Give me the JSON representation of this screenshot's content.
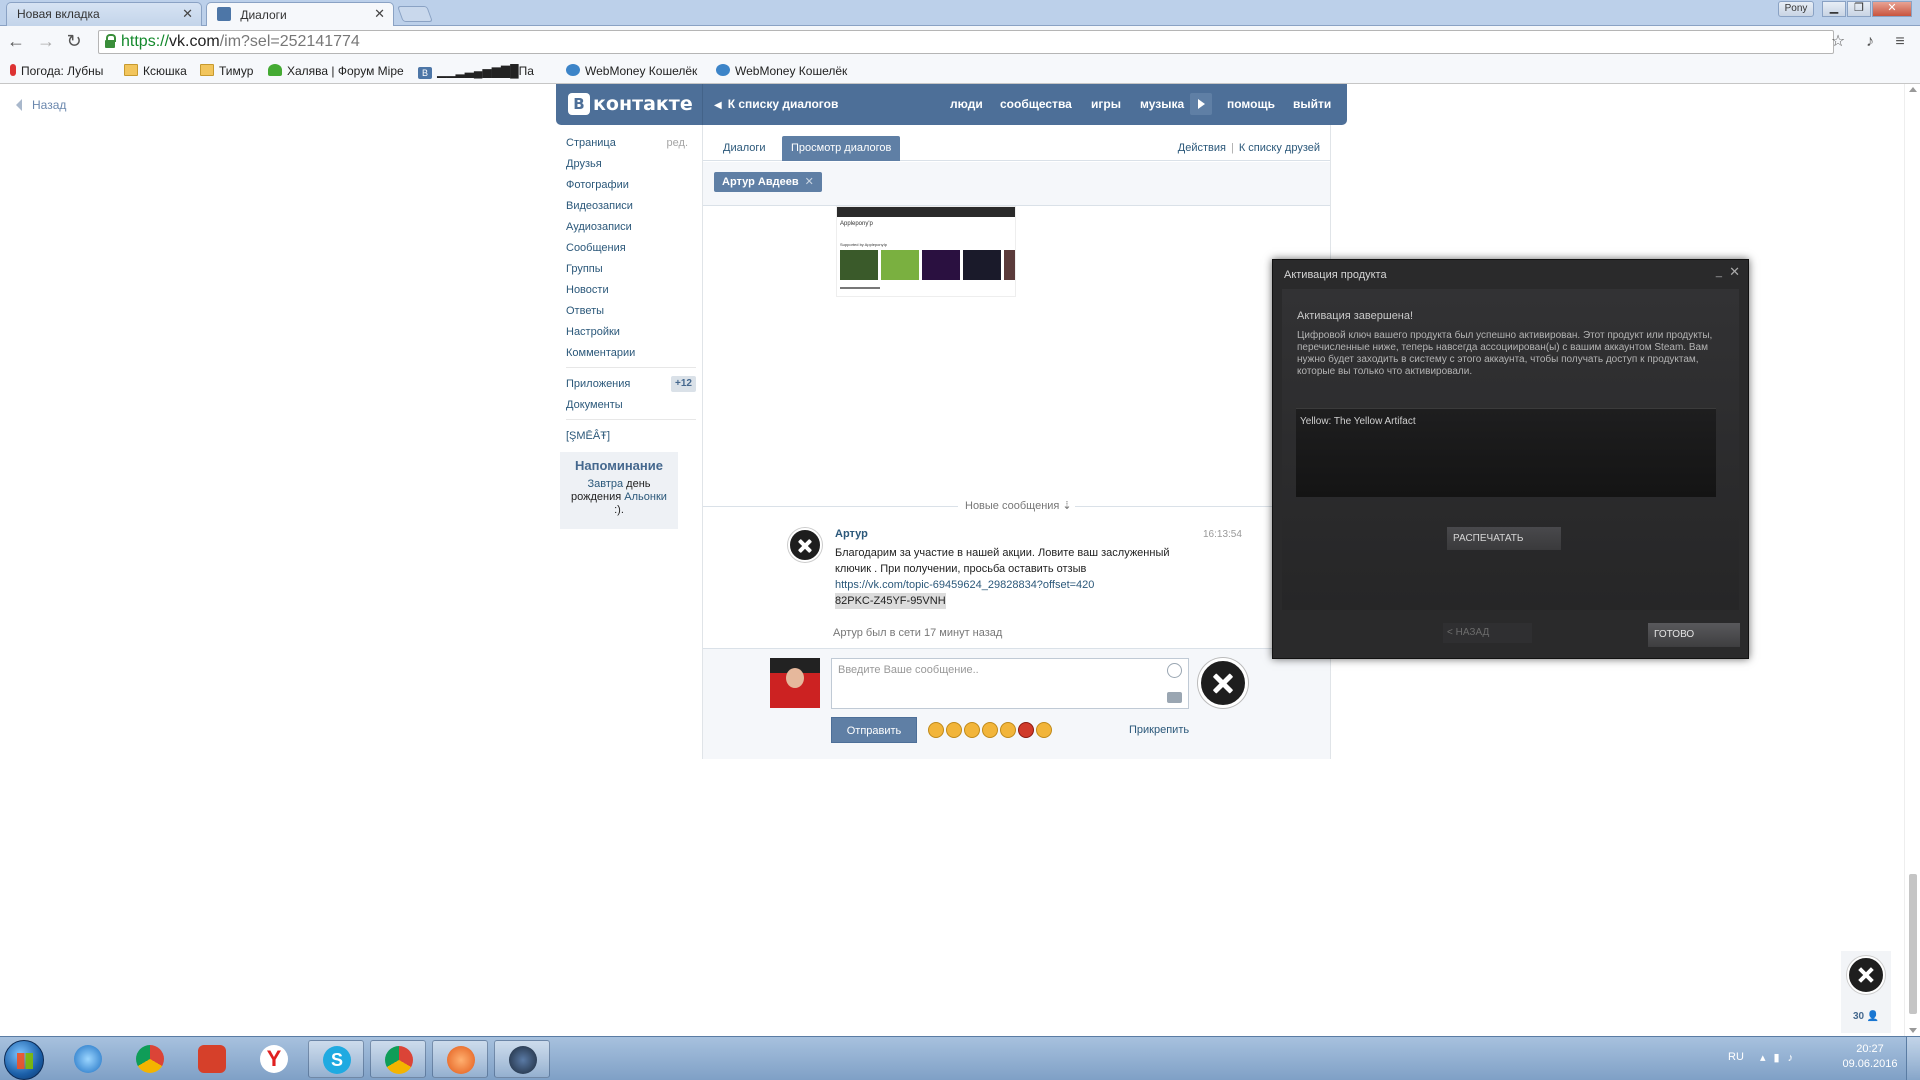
{
  "browser": {
    "tabs": [
      {
        "title": "Новая вкладка",
        "close": "✕"
      },
      {
        "title": "Диалоги",
        "close": "✕"
      }
    ],
    "profile": "Pony",
    "url_scheme": "https://",
    "url_host": "vk.com",
    "url_path": "/im?sel=252141774",
    "bookmarks": [
      {
        "label": "Погода: Лубны",
        "icon": "thermometer-icon"
      },
      {
        "label": "Ксюшка",
        "icon": "folder-icon"
      },
      {
        "label": "Тимур",
        "icon": "folder-icon"
      },
      {
        "label": "Халява | Форум Mipe",
        "icon": "figure-icon"
      },
      {
        "label": "▁▁▂▃▄▅▆▇█Па",
        "icon": "vk-icon"
      },
      {
        "label": "WebMoney Кошелёк",
        "icon": "globe-icon"
      },
      {
        "label": "WebMoney Кошелёк",
        "icon": "globe-icon"
      }
    ]
  },
  "page": {
    "back_label": "Назад"
  },
  "vk": {
    "logo_b": "В",
    "logo_text": "контакте",
    "back_to_list": "К списку диалогов",
    "nav": [
      "люди",
      "сообщества",
      "игры",
      "музыка",
      "помощь",
      "выйти"
    ],
    "left_menu": {
      "edit": "ред.",
      "items_main": [
        "Страница",
        "Друзья",
        "Фотографии",
        "Видеозаписи",
        "Аудиозаписи",
        "Сообщения",
        "Группы",
        "Новости",
        "Ответы",
        "Настройки",
        "Комментарии"
      ],
      "apps": "Приложения",
      "apps_badge": "+12",
      "docs": "Документы",
      "custom": "[ŞMĒÂŦ]"
    },
    "reminder": {
      "title": "Напоминание",
      "tomorrow": "Завтра",
      "mid": " день рождения ",
      "name": "Альонки",
      "tail": " :)."
    },
    "im": {
      "tab_dialogs": "Диалоги",
      "tab_view": "Просмотр диалогов",
      "actions": "Действия",
      "to_friends": "К списку друзей",
      "chip_name": "Артур Авдеев",
      "chip_close": "✕",
      "shot_label": "Applepony'p",
      "shot_sub": "Supported by AppleponyIp",
      "new_messages": "Новые сообщения ⇣",
      "message": {
        "author": "Артур",
        "time": "16:13:54",
        "text": "Благодарим за участие в нашей акции. Ловите ваш заслуженный ключик . При получении, просьба оставить отзыв",
        "link": "https://vk.com/topic-69459624_29828834?offset=420",
        "key": "82PKC-Z45YF-95VNH"
      },
      "online_status": "Артур был в сети 17 минут назад",
      "input_placeholder": "Введите Ваше сообщение..",
      "send": "Отправить",
      "attach": "Прикрепить"
    }
  },
  "steam": {
    "title": "Активация продукта",
    "minimize": "_",
    "close": "✕",
    "heading": "Активация завершена!",
    "description": "Цифровой ключ вашего продукта был успешно активирован. Этот продукт или продукты, перечисленные ниже, теперь навсегда ассоциирован(ы) с вашим аккаунтом Steam. Вам нужно будет заходить в систему с этого аккаунта, чтобы получать доступ к продуктам, которые вы только что активировали.",
    "product": "Yellow: The Yellow Artifact",
    "print": "РАСПЕЧАТАТЬ",
    "back": "< НАЗАД",
    "done": "ГОТОВО"
  },
  "sidebar_friends": {
    "count": "30 👤"
  },
  "taskbar": {
    "lang": "RU",
    "time": "20:27",
    "date": "09.06.2016"
  }
}
